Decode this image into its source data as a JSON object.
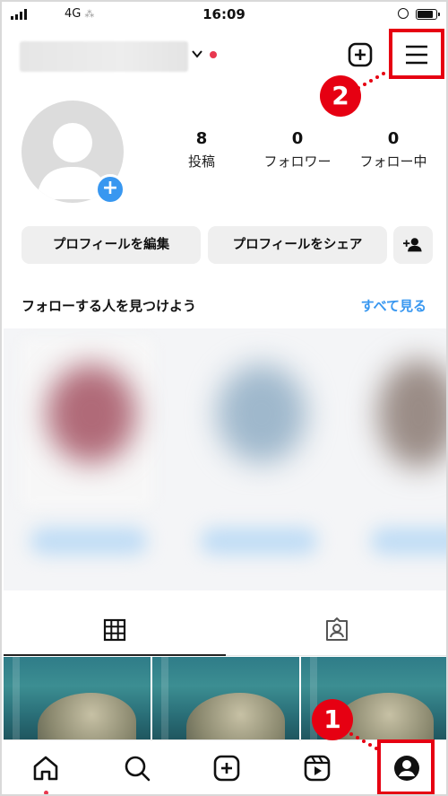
{
  "status_bar": {
    "carrier": "4G",
    "activity": "⁂",
    "time": "16:09"
  },
  "profile": {
    "stats": [
      {
        "value": "8",
        "label": "投稿"
      },
      {
        "value": "0",
        "label": "フォロワー"
      },
      {
        "value": "0",
        "label": "フォロー中"
      }
    ],
    "edit_button": "プロフィールを編集",
    "share_button": "プロフィールをシェア",
    "add_story_symbol": "+"
  },
  "discover": {
    "title": "フォローする人を見つけよう",
    "see_all": "すべて見る"
  },
  "annotations": {
    "step1": "1",
    "step2": "2",
    "highlight_color": "#e60012"
  },
  "colors": {
    "accent_blue": "#3897f0",
    "notification_red": "#e8384f"
  },
  "icons": {
    "header": [
      "create-icon",
      "menu-icon"
    ],
    "tabs": [
      "grid-icon",
      "tagged-icon"
    ],
    "bottom_nav": [
      "home-icon",
      "search-icon",
      "create-icon",
      "reels-icon",
      "profile-icon"
    ]
  }
}
